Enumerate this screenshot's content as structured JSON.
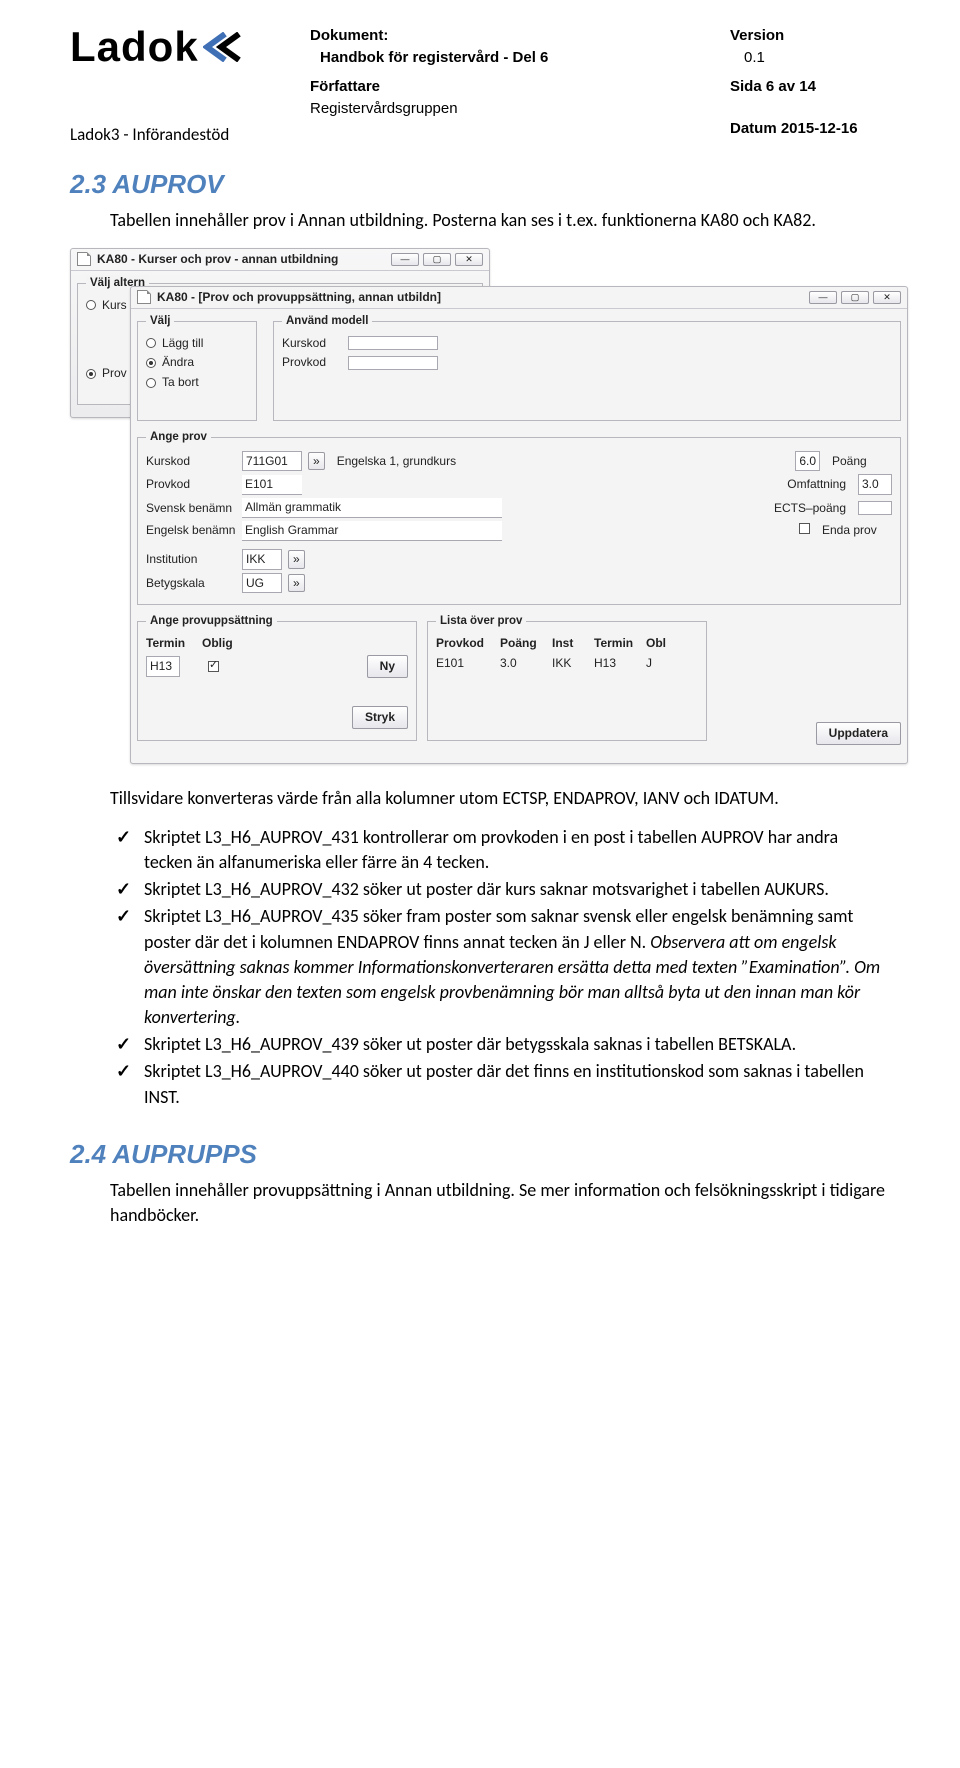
{
  "header": {
    "logo_text": "Ladok",
    "logo_sub": "Ladok3 - Införandestöd",
    "mid": {
      "dok_label": "Dokument:",
      "dok_title": "Handbok för registervård - Del 6",
      "auth_label": "Författare",
      "auth_value": "Registervårdsgruppen"
    },
    "right": {
      "ver_label": "Version",
      "ver_value": "0.1",
      "page_label_a": "Sida ",
      "page_label_b": " av ",
      "page_curr": "6",
      "page_total": "14",
      "date_label": "Datum ",
      "date_value": "2015-12-16"
    }
  },
  "section1": {
    "heading": "2.3 AUPROV",
    "intro_a": "Tabellen innehåller prov i Annan utbildning. Posterna kan ses i t.ex. funktionerna KA80 och KA82.",
    "para_after_shot": "Tillsvidare konverteras värde från alla kolumner utom ECTSP, ENDAPROV, IANV och IDATUM.",
    "bullets": [
      "Skriptet L3_H6_AUPROV_431 kontrollerar om provkoden i en post i tabellen AUPROV har andra tecken än alfanumeriska eller färre än 4 tecken.",
      "Skriptet L3_H6_AUPROV_432 söker ut poster där kurs saknar motsvarighet i tabellen AUKURS.",
      "Skriptet L3_H6_AUPROV_435 söker fram poster som saknar svensk eller engelsk benämning samt poster där det i kolumnen ENDAPROV finns annat tecken än J eller N. ",
      "Skriptet L3_H6_AUPROV_439 söker ut poster där betygsskala saknas i tabellen BETSKALA.",
      "Skriptet L3_H6_AUPROV_440 söker ut poster där det finns en institutionskod som saknas i tabellen INST."
    ],
    "bullet3_italic": "Observera att om engelsk översättning saknas kommer Informationskonverteraren ersätta detta med texten ”Examination”. Om man inte önskar den texten som engelsk provbenämning bör man alltså byta ut den innan man kör konvertering."
  },
  "section2": {
    "heading": "2.4 AUPRUPPS",
    "para": "Tabellen innehåller provuppsättning i Annan utbildning. Se mer information och felsökningsskript i tidigare handböcker."
  },
  "shot": {
    "win1": {
      "title": "KA80 - Kurser och prov - annan utbildning",
      "legend": "Välj altern",
      "opt_kurs": "Kurs",
      "opt_provo": "Prov o"
    },
    "win2": {
      "title": "KA80 - [Prov och provuppsättning, annan utbildn]",
      "fs_valj": {
        "legend": "Välj",
        "add": "Lägg till",
        "change": "Ändra",
        "remove": "Ta bort"
      },
      "fs_model": {
        "legend": "Använd modell",
        "kurskod": "Kurskod",
        "provkod": "Provkod"
      },
      "fs_ange": {
        "legend": "Ange prov",
        "kurskod_l": "Kurskod",
        "kurskod_v": "711G01",
        "kurs_name": "Engelska 1, grundkurs",
        "poang_l": "Poäng",
        "poang_v": "6.0",
        "provkod_l": "Provkod",
        "provkod_v": "E101",
        "omf_l": "Omfattning",
        "omf_v": "3.0",
        "svb_l": "Svensk benämn",
        "svb_v": "Allmän grammatik",
        "ects_l": "ECTS–poäng",
        "enb_l": "Engelsk benämn",
        "enb_v": "English Grammar",
        "enda_l": "Enda prov",
        "inst_l": "Institution",
        "inst_v": "IKK",
        "bet_l": "Betygskala",
        "bet_v": "UG"
      },
      "fs_set": {
        "legend": "Ange provuppsättning",
        "termin_l": "Termin",
        "oblig_l": "Oblig",
        "termin_v": "H13",
        "btn_ny": "Ny",
        "btn_stryk": "Stryk"
      },
      "fs_list": {
        "legend": "Lista över prov",
        "h1": "Provkod",
        "h2": "Poäng",
        "h3": "Inst",
        "h4": "Termin",
        "h5": "Obl",
        "r1c1": "E101",
        "r1c2": "3.0",
        "r1c3": "IKK",
        "r1c4": "H13",
        "r1c5": "J"
      },
      "btn_upd": "Uppdatera"
    }
  }
}
